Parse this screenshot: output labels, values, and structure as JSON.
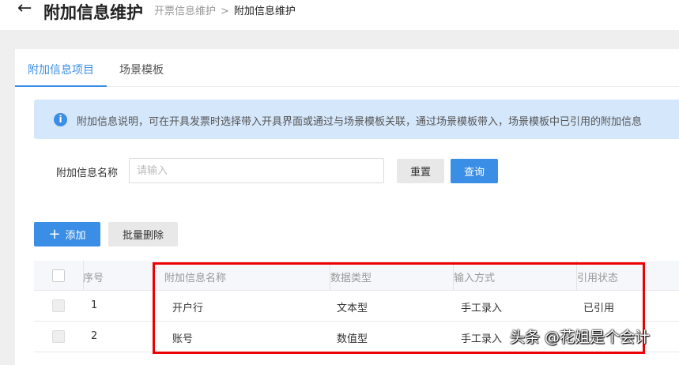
{
  "header": {
    "title": "附加信息维护",
    "breadcrumb": [
      "开票信息维护",
      "附加信息维护"
    ],
    "sep": ">"
  },
  "tabs": [
    "附加信息项目",
    "场景模板"
  ],
  "banner": "附加信息说明，可在开具发票时选择带入开具界面或通过与场景模板关联，通过场景模板带入，场景模板中已引用的附加信息",
  "form": {
    "label": "附加信息名称",
    "placeholder": "请输入",
    "reset": "重置",
    "query": "查询"
  },
  "toolbar": {
    "add": "添加",
    "batch_delete": "批量删除"
  },
  "table": {
    "columns": [
      "序号",
      "附加信息名称",
      "数据类型",
      "输入方式",
      "引用状态"
    ],
    "rows": [
      [
        "1",
        "开户行",
        "文本型",
        "手工录入",
        "已引用"
      ],
      [
        "2",
        "账号",
        "数值型",
        "手工录入",
        ""
      ]
    ]
  },
  "watermark": "头条 @花姐是个会计"
}
